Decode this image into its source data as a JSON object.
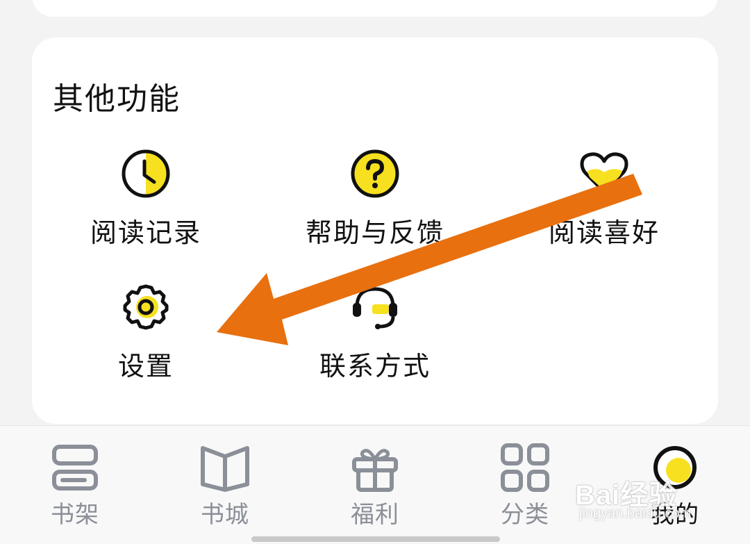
{
  "section": {
    "title": "其他功能"
  },
  "functions": [
    {
      "label": "阅读记录",
      "icon": "clock-icon"
    },
    {
      "label": "帮助与反馈",
      "icon": "question-icon"
    },
    {
      "label": "阅读喜好",
      "icon": "heart-icon"
    },
    {
      "label": "设置",
      "icon": "gear-icon"
    },
    {
      "label": "联系方式",
      "icon": "headset-icon"
    }
  ],
  "tabbar": {
    "tabs": [
      {
        "label": "书架",
        "icon": "bookshelf-icon"
      },
      {
        "label": "书城",
        "icon": "book-open-icon"
      },
      {
        "label": "福利",
        "icon": "gift-icon"
      },
      {
        "label": "分类",
        "icon": "grid-icon"
      },
      {
        "label": "我的",
        "icon": "profile-circle-icon",
        "active": true
      }
    ]
  },
  "watermark": {
    "main": "Bai经验",
    "sub": "jingyan.baidu.com"
  },
  "colors": {
    "accent": "#f7e01f",
    "arrow": "#e8700f",
    "tab_inactive": "#8b8f98"
  }
}
